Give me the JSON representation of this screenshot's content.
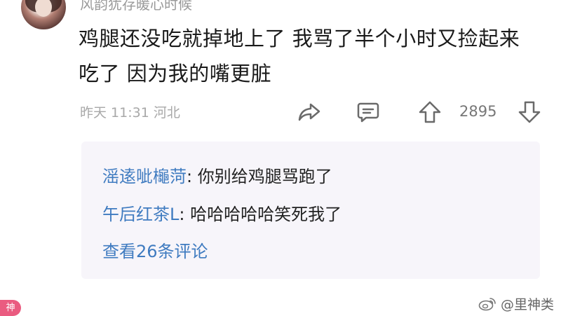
{
  "comment": {
    "username": "风韵犹存暖心时候",
    "text": "鸡腿还没吃就掉地上了 我骂了半个小时又捡起来吃了 因为我的嘴更脏",
    "meta": "昨天 11:31 河北",
    "like_count": "2895"
  },
  "replies": {
    "items": [
      {
        "name": "滛逺呲櫷菏",
        "separator": ": ",
        "text": "你别给鸡腿骂跑了"
      },
      {
        "name": "午后红茶L",
        "separator": ": ",
        "text": "哈哈哈哈哈笑死我了"
      }
    ],
    "view_more": "查看26条评论"
  },
  "icons": {
    "share": "share-icon",
    "reply": "comment-icon",
    "upvote": "upvote-arrow-icon",
    "downvote": "downvote-arrow-icon",
    "watermark_logo": "weibo-logo-icon"
  },
  "badge": {
    "label": "神"
  },
  "watermark": {
    "text": "@里神类"
  },
  "colors": {
    "link": "#3f7bc0",
    "reply_background": "#f7f5fa",
    "meta": "#a8a8a8",
    "badge": "#ea5b80"
  }
}
